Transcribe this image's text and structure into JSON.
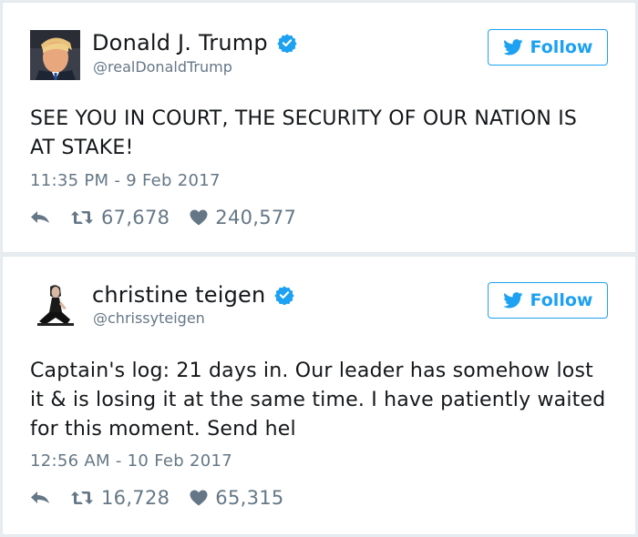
{
  "colors": {
    "accent": "#1da1f2",
    "text": "#14171a",
    "muted": "#657786",
    "background": "#e6ecf0"
  },
  "tweets": [
    {
      "display_name": "Donald J. Trump",
      "handle": "@realDonaldTrump",
      "verified": true,
      "follow_label": "Follow",
      "text": "SEE YOU IN COURT, THE SECURITY OF OUR NATION IS AT STAKE!",
      "timestamp": "11:35 PM - 9 Feb 2017",
      "retweets": "67,678",
      "likes": "240,577"
    },
    {
      "display_name": "christine teigen",
      "handle": "@chrissyteigen",
      "verified": true,
      "follow_label": "Follow",
      "text": "Captain's log: 21 days in. Our leader has somehow lost it & is losing it at the same time. I have patiently waited for this moment. Send hel",
      "timestamp": "12:56 AM - 10 Feb 2017",
      "retweets": "16,728",
      "likes": "65,315"
    }
  ]
}
